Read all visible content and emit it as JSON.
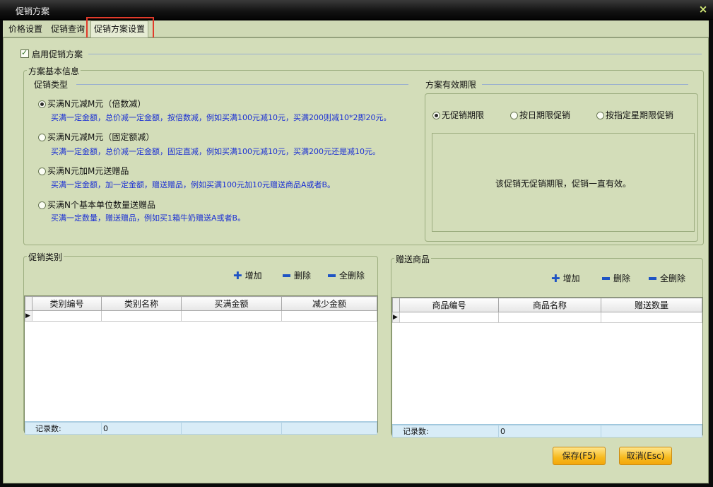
{
  "window": {
    "title": "促销方案",
    "close_glyph": "×"
  },
  "tabs": [
    {
      "label": "价格设置"
    },
    {
      "label": "促销查询"
    },
    {
      "label": "促销方案设置",
      "active": true
    }
  ],
  "enable": {
    "label": "启用促销方案",
    "checked": true
  },
  "basic": {
    "title": "方案基本信息",
    "type_title": "促销类型",
    "options": [
      {
        "label": "买满N元减M元（倍数减）",
        "desc": "买满一定金额，总价减一定金额，按倍数减，例如买满100元减10元，买满200则减10*2即20元。",
        "selected": true
      },
      {
        "label": "买满N元减M元（固定额减）",
        "desc": "买满一定金额，总价减一定金额，固定直减，例如买满100元减10元，买满200元还是减10元。",
        "selected": false
      },
      {
        "label": "买满N元加M元送赠品",
        "desc": "买满一定金额，加一定金额，赠送赠品，例如买满100元加10元赠送商品A或者B。",
        "selected": false
      },
      {
        "label": "买满N个基本单位数量送赠品",
        "desc": "买满一定数量，赠送赠品，例如买1箱牛奶赠送A或者B。",
        "selected": false
      }
    ],
    "validity": {
      "title": "方案有效期限",
      "options": [
        {
          "label": "无促销期限",
          "selected": true
        },
        {
          "label": "按日期限促销",
          "selected": false
        },
        {
          "label": "按指定星期限促销",
          "selected": false
        }
      ],
      "message": "该促销无促销期限，促销一直有效。"
    }
  },
  "category": {
    "title": "促销类别",
    "add": "增加",
    "delete": "删除",
    "delete_all": "全删除",
    "columns": [
      "类别编号",
      "类别名称",
      "买满金额",
      "减少金额"
    ],
    "record_label": "记录数:",
    "record_count": "0"
  },
  "gift": {
    "title": "赠送商品",
    "add": "增加",
    "delete": "删除",
    "delete_all": "全删除",
    "columns": [
      "商品编号",
      "商品名称",
      "赠送数量"
    ],
    "record_label": "记录数:",
    "record_count": "0"
  },
  "buttons": {
    "save": "保存(F5)",
    "cancel": "取消(Esc)"
  },
  "colors": {
    "accent_border": "#e23a2a",
    "panel_bg": "#d3ddb9",
    "desc_text": "#1a2fd4",
    "button_bg": "#f7b91d"
  }
}
